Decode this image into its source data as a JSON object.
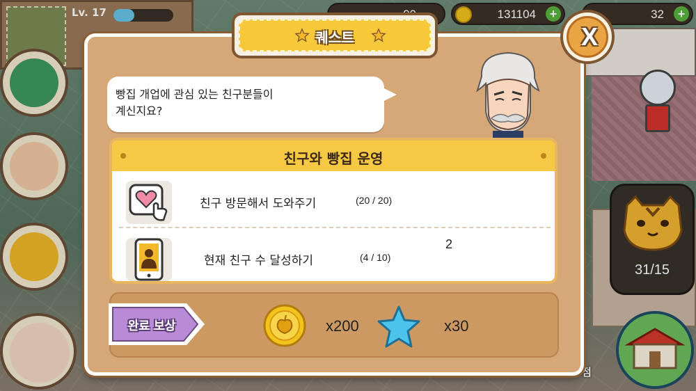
{
  "hud": {
    "level_label": "Lv. 17",
    "level_progress": 0.35,
    "coins": "131104",
    "gems": "32",
    "hidden_counter": "00"
  },
  "quest_window": {
    "title": "퀘스트",
    "close_label": "X",
    "dialogue": "빵집 개업에 관심 있는 친구분들이\n계신지요?",
    "quest_group": "친구와 빵집 운영",
    "quests": [
      {
        "icon": "heart-tap-icon",
        "label": "친구 방문해서 도와주기",
        "progress": "(20 / 20)"
      },
      {
        "icon": "phone-friend-icon",
        "label": "현재 친구 수 달성하기",
        "progress": "(4 / 10)"
      }
    ],
    "stray_text": "2",
    "reward_label": "완료 보상",
    "rewards": [
      {
        "icon": "gold-coin-icon",
        "qty": "x200"
      },
      {
        "icon": "blue-star-icon",
        "qty": "x30"
      }
    ]
  },
  "side_panel": {
    "tiger_count": "31/15",
    "shop_label": "점"
  },
  "colors": {
    "modal_bg": "#d7a877",
    "header_yellow": "#f6c843",
    "reward_tag": "#b98ad6",
    "star_blue": "#4cc3ea",
    "coin_gold": "#f2c31c"
  }
}
